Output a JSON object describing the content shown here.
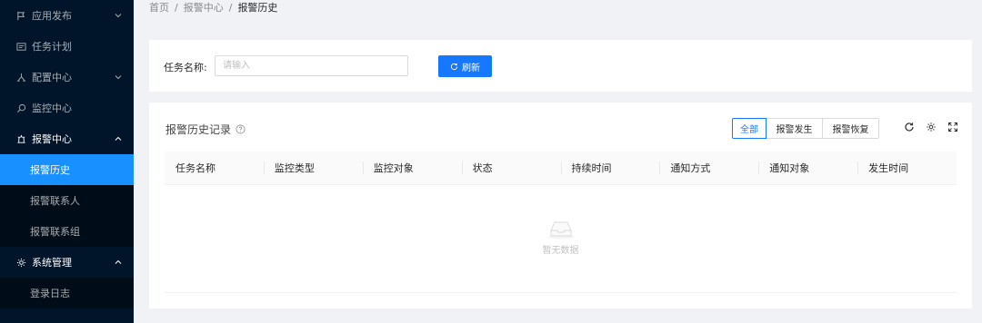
{
  "sidebar": {
    "menu": [
      {
        "label": "应用发布",
        "icon": "flag-icon",
        "arrow": "down"
      },
      {
        "label": "任务计划",
        "icon": "schedule-icon",
        "arrow": ""
      },
      {
        "label": "配置中心",
        "icon": "cluster-icon",
        "arrow": "down"
      },
      {
        "label": "监控中心",
        "icon": "search-icon",
        "arrow": ""
      },
      {
        "label": "报警中心",
        "icon": "alert-icon",
        "arrow": "up",
        "children": [
          "报警历史",
          "报警联系人",
          "报警联系组"
        ],
        "active_child": "报警历史"
      },
      {
        "label": "系统管理",
        "icon": "gear-icon",
        "arrow": "up",
        "children": [
          "登录日志"
        ]
      }
    ]
  },
  "breadcrumb": [
    "首页",
    "报警中心",
    "报警历史"
  ],
  "search": {
    "label": "任务名称:",
    "placeholder": "请输入",
    "value": "",
    "refresh_label": "刷新"
  },
  "table": {
    "title": "报警历史记录",
    "filters": [
      "全部",
      "报警发生",
      "报警恢复"
    ],
    "active_filter": "全部",
    "columns": [
      "任务名称",
      "监控类型",
      "监控对象",
      "状态",
      "持续时间",
      "通知方式",
      "通知对象",
      "发生时间"
    ],
    "rows": [],
    "empty_text": "暂无数据"
  },
  "colors": {
    "sidebar_bg": "#001529",
    "submenu_bg": "#000c17",
    "primary": "#1677ff"
  }
}
